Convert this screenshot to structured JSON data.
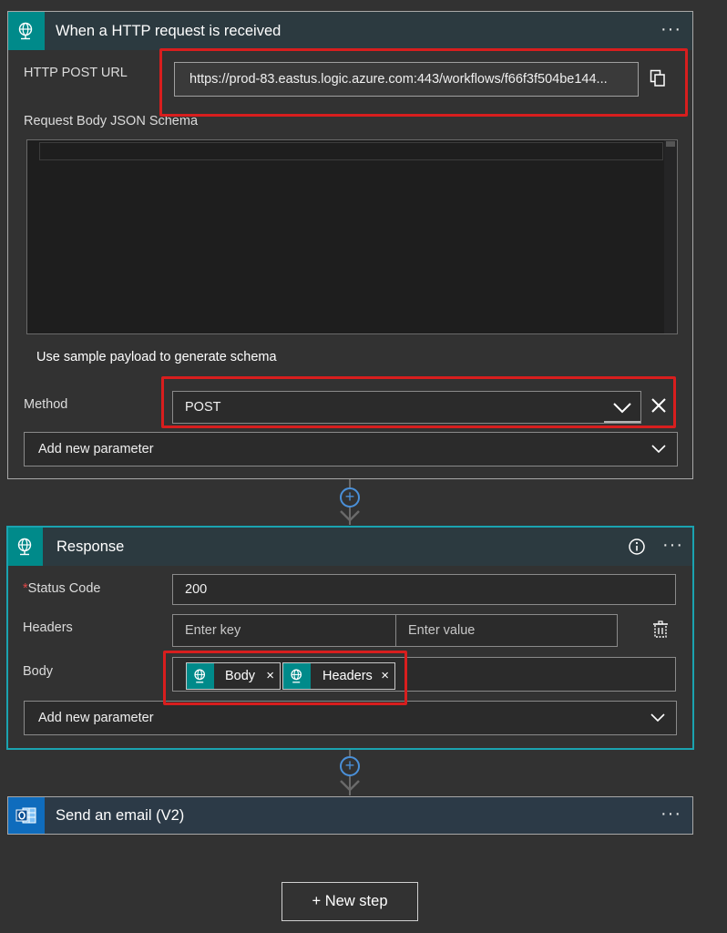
{
  "trigger_card": {
    "title": "When a HTTP request is received",
    "more_label": "···",
    "http_post_url_label": "HTTP POST URL",
    "http_post_url_value": "https://prod-83.eastus.logic.azure.com:443/workflows/f66f3f504be144...",
    "schema_label": "Request Body JSON Schema",
    "sample_payload_link": "Use sample payload to generate schema",
    "method_label": "Method",
    "method_value": "POST",
    "add_param_label": "Add new parameter"
  },
  "response_card": {
    "title": "Response",
    "more_label": "···",
    "status_required_mark": "*",
    "status_code_label": "Status Code",
    "status_code_value": "200",
    "headers_label": "Headers",
    "headers_key_placeholder": "Enter key",
    "headers_value_placeholder": "Enter value",
    "body_label": "Body",
    "body_tokens": [
      {
        "label": "Body",
        "remove": "×"
      },
      {
        "label": "Headers",
        "remove": "×"
      }
    ],
    "add_param_label": "Add new parameter"
  },
  "email_card": {
    "title": "Send an email (V2)",
    "more_label": "···"
  },
  "new_step_label": "+ New step",
  "colors": {
    "background": "#323232",
    "card_header": "#2e3a42",
    "trigger_icon": "#008a8a",
    "outlook_icon": "#0f6cbd",
    "highlight": "#d81e1e",
    "response_border": "#1aa3b0"
  },
  "icons": {
    "trigger": "globe-request-icon",
    "response": "globe-request-icon",
    "email": "outlook-icon",
    "copy": "copy-icon",
    "chevron": "chevron-down-icon",
    "clear": "close-icon",
    "info": "info-icon",
    "delete": "delete-icon"
  }
}
